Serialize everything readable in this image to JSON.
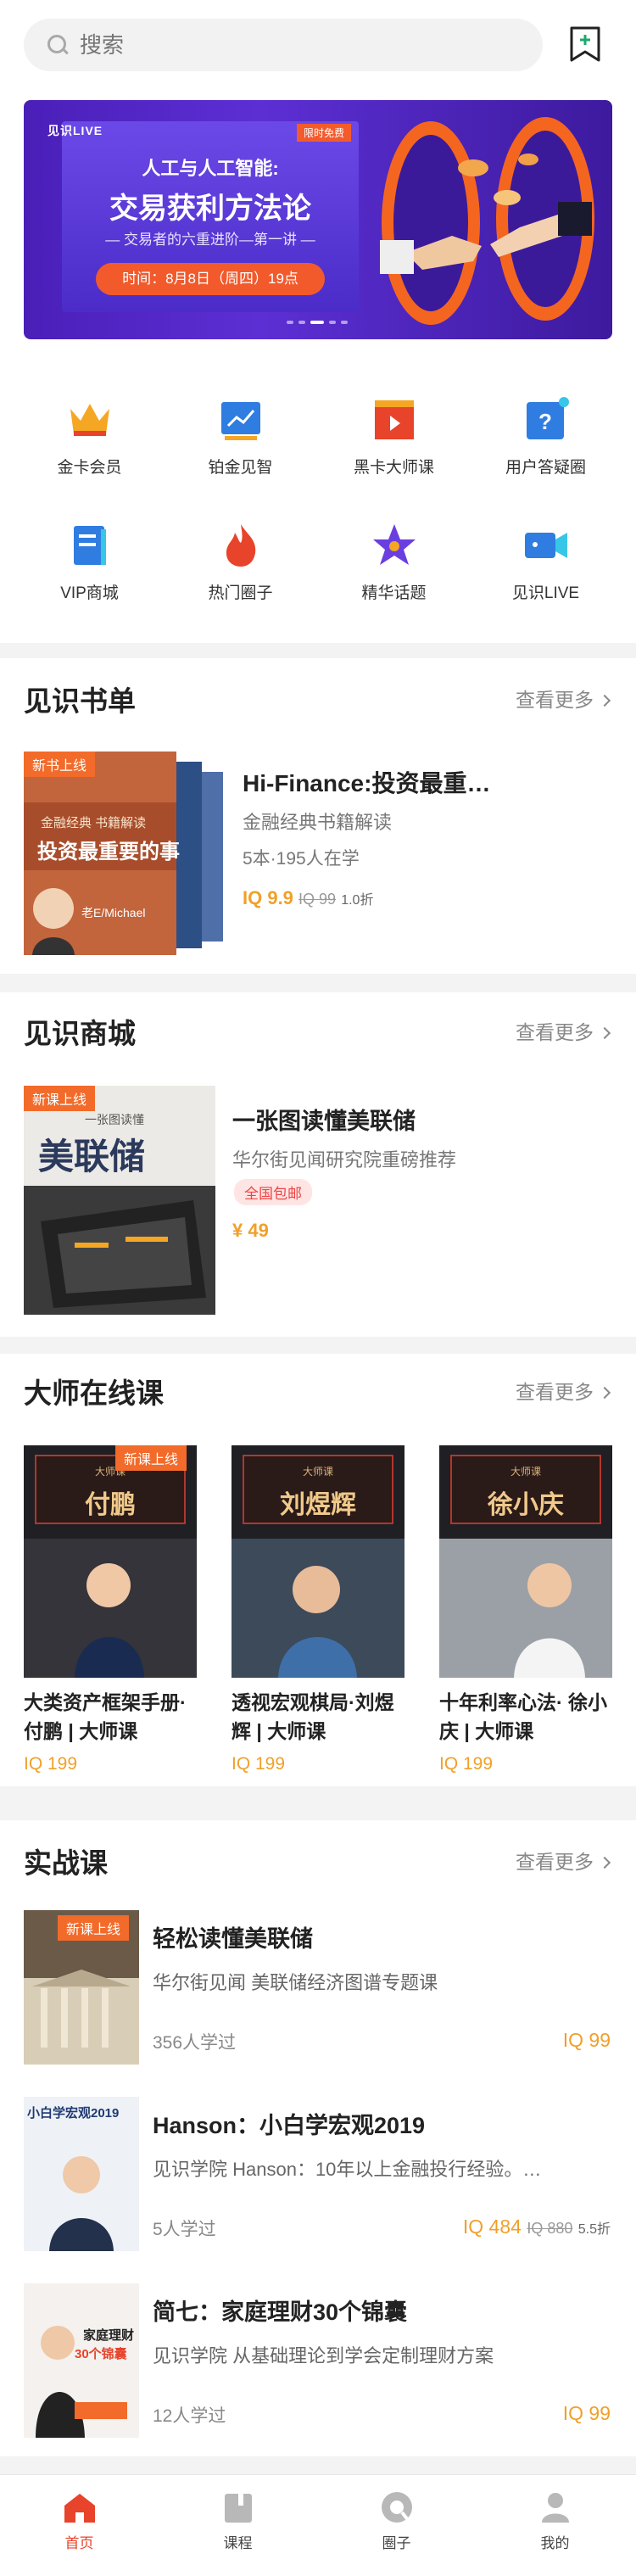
{
  "search": {
    "placeholder": "搜索"
  },
  "banner": {
    "logo": "见识LIVE",
    "badge": "限时免费",
    "line1": "人工与人工智能:",
    "line2": "交易获利方法论",
    "line3": "— 交易者的六重进阶—第一讲 —",
    "time": "时间：8月8日（周四）19点",
    "active_dot": 3
  },
  "quick": [
    {
      "label": "金卡会员",
      "icon": "crown-icon"
    },
    {
      "label": "铂金见智",
      "icon": "chart-trend-icon"
    },
    {
      "label": "黑卡大师课",
      "icon": "video-play-icon"
    },
    {
      "label": "用户答疑圈",
      "icon": "question-icon"
    },
    {
      "label": "VIP商城",
      "icon": "book-icon"
    },
    {
      "label": "热门圈子",
      "icon": "flame-icon"
    },
    {
      "label": "精华话题",
      "icon": "star-icon"
    },
    {
      "label": "见识LIVE",
      "icon": "camera-icon"
    }
  ],
  "more_label": "查看更多",
  "booklist": {
    "title": "见识书单",
    "tag": "新书上线",
    "cover_series": "金融经典 书籍解读",
    "cover_title": "投资最重要的事",
    "cover_author": "老E/Michael",
    "item_title": "Hi-Finance:投资最重…",
    "item_sub": "金融经典书籍解读",
    "item_meta": "5本·195人在学",
    "price": "IQ 9.9",
    "orig_price": "IQ 99",
    "discount": "1.0折"
  },
  "mall": {
    "title": "见识商城",
    "tag": "新课上线",
    "cover_kicker": "一张图读懂",
    "cover_title": "美联储",
    "item_title": "一张图读懂美联储",
    "item_sub": "华尔街见闻研究院重磅推荐",
    "pill": "全国包邮",
    "price": "¥ 49"
  },
  "masters": {
    "title": "大师在线课",
    "items": [
      {
        "header": "大师课",
        "name": "付鹏",
        "tag": "新课上线",
        "title": "大类资产框架手册·付鹏 | 大师课",
        "price": "IQ 199"
      },
      {
        "header": "大师课",
        "name": "刘煜辉",
        "tag": "",
        "title": "透视宏观棋局·刘煜辉 | 大师课",
        "price": "IQ 199"
      },
      {
        "header": "大师课",
        "name": "徐小庆",
        "tag": "",
        "title": "十年利率心法· 徐小庆 | 大师课",
        "price": "IQ 199"
      }
    ]
  },
  "practice": {
    "title": "实战课",
    "items": [
      {
        "tag": "新课上线",
        "title": "轻松读懂美联储",
        "sub": "华尔街见闻 美联储经济图谱专题课",
        "meta": "356人学过",
        "price": "IQ 99",
        "orig": "",
        "discount": ""
      },
      {
        "tag": "",
        "title": "Hanson：小白学宏观2019",
        "sub": "见识学院 Hanson：10年以上金融投行经验。…",
        "meta": "5人学过",
        "price": "IQ 484",
        "orig": "IQ 880",
        "discount": "5.5折"
      },
      {
        "tag": "",
        "title": "简七：家庭理财30个锦囊",
        "sub": "见识学院 从基础理论到学会定制理财方案",
        "meta": "12人学过",
        "price": "IQ 99",
        "orig": "",
        "discount": ""
      }
    ],
    "cover2_title": "小白学宏观2019",
    "cover3_title": "家庭理财",
    "cover3_sub": "30个锦囊"
  },
  "nav": [
    {
      "label": "首页",
      "icon": "home-icon",
      "active": true
    },
    {
      "label": "课程",
      "icon": "course-icon",
      "active": false
    },
    {
      "label": "圈子",
      "icon": "circle-icon",
      "active": false
    },
    {
      "label": "我的",
      "icon": "profile-icon",
      "active": false
    }
  ],
  "colors": {
    "accent": "#e8432b",
    "price": "#f0a02a",
    "tag": "#f26b2a"
  }
}
